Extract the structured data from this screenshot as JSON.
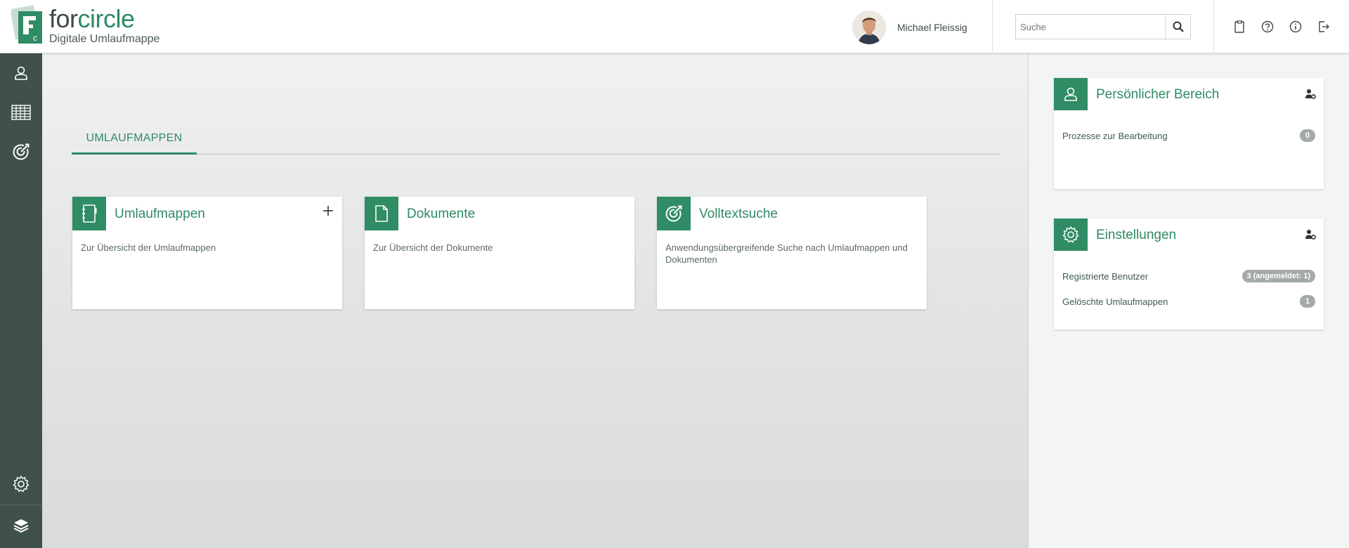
{
  "brand": {
    "name_part1": "for",
    "name_part2": "circle",
    "subtitle": "Digitale Umlaufmappe"
  },
  "user": {
    "name": "Michael Fleissig"
  },
  "search": {
    "placeholder": "Suche"
  },
  "header_icons": [
    "clipboard-icon",
    "help-icon",
    "info-icon",
    "logout-icon"
  ],
  "leftnav": {
    "top_items": [
      "user-icon",
      "table-icon",
      "target-icon"
    ],
    "bottom_items": [
      "settings-icon",
      "layers-icon"
    ]
  },
  "tabs": [
    {
      "label": "UMLAUFMAPPEN",
      "active": true
    }
  ],
  "cards": [
    {
      "title": "Umlaufmappen",
      "description": "Zur Übersicht der Umlaufmappen",
      "icon": "folder-book-icon",
      "has_add": true
    },
    {
      "title": "Dokumente",
      "description": "Zur Übersicht der Dokumente",
      "icon": "document-icon"
    },
    {
      "title": "Volltextsuche",
      "description": "Anwendungsübergreifende Suche nach Umlaufmappen und Dokumenten",
      "icon": "target-icon"
    }
  ],
  "widgets": {
    "personal": {
      "title": "Persönlicher Bereich",
      "rows": [
        {
          "label": "Prozesse zur Bearbeitung",
          "badge": "0"
        }
      ]
    },
    "settings": {
      "title": "Einstellungen",
      "rows": [
        {
          "label": "Registrierte Benutzer",
          "badge": "3 (angemeldet: 1)"
        },
        {
          "label": "Gelöschte Umlaufmappen",
          "badge": "1"
        }
      ]
    }
  },
  "colors": {
    "accent": "#2e8a63",
    "sidebar": "#3f504d",
    "badge": "#a3aaa8"
  }
}
